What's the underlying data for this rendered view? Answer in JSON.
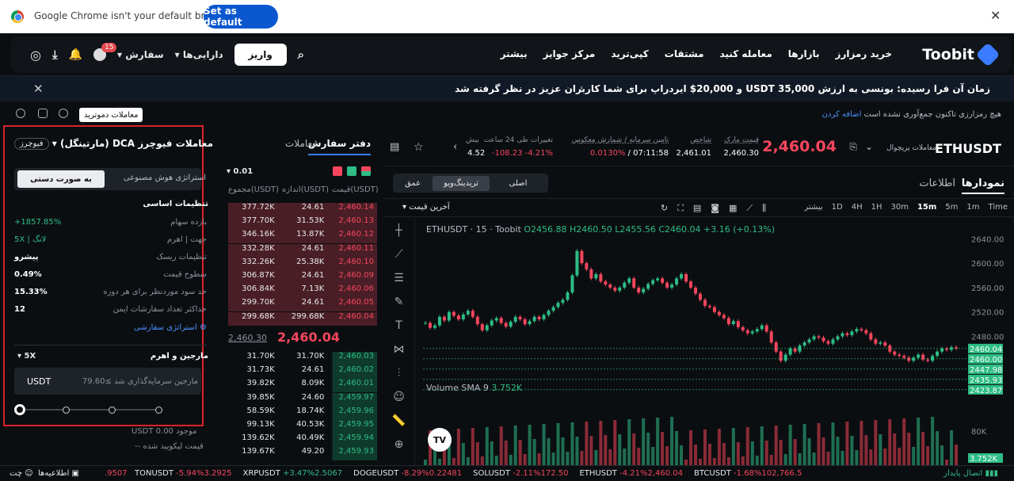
{
  "chrome": {
    "message": "Google Chrome isn't your default browser",
    "set_default": "Set as default"
  },
  "nav": {
    "brand": "Toobit",
    "items": [
      "خرید رمزارز",
      "بازارها",
      "معامله کنید",
      "مشتقات",
      "کپی‌ترید",
      "مرکز جوایز",
      "بیشتر"
    ],
    "deposit": "واریز",
    "assets": "دارایی‌ها",
    "orders": "سفارش",
    "badge": "15"
  },
  "banner": {
    "text": "زمان آن فرا رسیده: بونسی به ارزش USDT 35,000 و 20,000$ ایردراپ برای شما کاربران عزیز در نظر گرفته شد"
  },
  "subbar": {
    "demo": "معاملات دموترید",
    "notice": "هیچ رمزارزی تاکنون جمع‌آوری نشده است",
    "notice_link": "اضافه کردن"
  },
  "left_panel": {
    "title": "معاملات فیوچرز DCA (مارتینگل)",
    "type_btn": "فیوچرز",
    "tabs": [
      "استراتژی هوش مصنوعی",
      "به صورت دستی"
    ],
    "basic": "تنظیمات اساسی",
    "rows": [
      [
        "بازده سهام",
        "1857.85%+"
      ],
      [
        "جهت | اهرم",
        "لانگ | 5X"
      ],
      [
        "تنظیمات ریسک",
        "پیشرو"
      ],
      [
        "سطوح قیمت",
        "0.49%"
      ],
      [
        "حد سود موردنظر برای هر دوره",
        "15.33%"
      ],
      [
        "حداکثر تعداد سفارشات ایمن",
        "12"
      ]
    ],
    "strategy": "استراتژی سفارشی",
    "margin": "مارجین و اهرم",
    "lev": "5X",
    "input_placeholder": "مارجین سرمایه‌گذاری شد ≥79.60",
    "unit": "USDT"
  },
  "orderbook": {
    "tabs": [
      "دفتر سفارش",
      "معاملات"
    ],
    "precision": "0.01",
    "headers": [
      "قیمت(USDT)",
      "اندازه(USDT)",
      "مجموع(USDT)"
    ],
    "asks": [
      [
        "2,460.14",
        "24.61",
        "377.72K"
      ],
      [
        "2,460.13",
        "31.53K",
        "377.70K"
      ],
      [
        "2,460.12",
        "13.87K",
        "346.16K"
      ],
      [
        "2,460.11",
        "24.61",
        "332.28K"
      ],
      [
        "2,460.10",
        "25.38K",
        "332.26K"
      ],
      [
        "2,460.09",
        "24.61",
        "306.87K"
      ],
      [
        "2,460.06",
        "7.13K",
        "306.84K"
      ],
      [
        "2,460.05",
        "24.61",
        "299.70K"
      ],
      [
        "2,460.04",
        "299.68K",
        "299.68K"
      ]
    ],
    "last": "2,460.04",
    "mark": "2,460.30",
    "bids": [
      [
        "2,460.03",
        "31.70K",
        "31.70K"
      ],
      [
        "2,460.02",
        "24.61",
        "31.73K"
      ],
      [
        "2,460.01",
        "8.09K",
        "39.82K"
      ],
      [
        "2,459.97",
        "24.60",
        "39.85K"
      ],
      [
        "2,459.96",
        "18.74K",
        "58.59K"
      ],
      [
        "2,459.95",
        "40.53K",
        "99.13K"
      ],
      [
        "2,459.94",
        "40.49K",
        "139.62K"
      ],
      [
        "2,459.93",
        "49.20",
        "139.67K"
      ]
    ]
  },
  "ticker": {
    "symbol": "ETHUSDT",
    "kind": "معاملات پرپچوال",
    "price": "2,460.04",
    "mark_label": "قیمت مارک",
    "mark": "2,460.30",
    "index_label": "شاخص",
    "index": "2,461.01",
    "funding_label": "تامین سرمایه / شمارش معکوس",
    "funding": "0.0130%",
    "countdown": "07:11:58",
    "change_label": "تغییرات طی 24 ساعت",
    "change": "-108.23 -4.21%",
    "high_label": "بیش",
    "high": "4.52"
  },
  "chart_tabs": {
    "main": "نمودارها",
    "info": "اطلاعات",
    "views": [
      "اصلی",
      "تریدینگ‌ویو",
      "عمق"
    ],
    "times": [
      "Time",
      "1m",
      "5m",
      "15m",
      "30m",
      "1H",
      "4H",
      "1D",
      "بیشتر"
    ],
    "last_price": "آخرین قیمت"
  },
  "chart_legend": {
    "symbol": "ETHUSDT · 15 · Toobit",
    "o": "O2456.88",
    "h": "H2460.50",
    "l": "L2455.56",
    "c": "C2460.04",
    "chg": "+3.16 (+0.13%)",
    "vol": "Volume SMA 9",
    "vol_val": "3.752K"
  },
  "price_axis": [
    "2640.00",
    "2600.00",
    "2560.00",
    "2520.00",
    "2480.00",
    "2460.04",
    "2460.00",
    "2447.98",
    "2435.93",
    "2423.87",
    "80K",
    "3.752K"
  ],
  "footer": {
    "items": [
      [
        "TONUSDT",
        "-5.94%3.2925"
      ],
      [
        "XRPUSDT",
        "+3.47%2.5067"
      ],
      [
        "DOGEUSDT",
        "-8.29%0.22481"
      ],
      [
        "SOLUSDT",
        "-2.11%172.50"
      ],
      [
        "ETHUSDT",
        "-4.21%2,460.04"
      ],
      [
        "BTCUSDT",
        "-1.68%102,766.5"
      ]
    ],
    "first_val": ".9507",
    "conn": "اتصال پایدار",
    "chat": "چت",
    "notice": "اطلاعیه‌ها"
  },
  "chart_data": {
    "type": "candlestick",
    "symbol": "ETHUSDT",
    "interval": "15",
    "ylim": [
      2400,
      2660
    ],
    "closes": [
      2502,
      2494,
      2498,
      2512,
      2506,
      2520,
      2514,
      2508,
      2516,
      2522,
      2512,
      2500,
      2490,
      2498,
      2506,
      2510,
      2502,
      2496,
      2504,
      2512,
      2508,
      2500,
      2505,
      2512,
      2508,
      2515,
      2522,
      2528,
      2535,
      2540,
      2552,
      2580,
      2620,
      2600,
      2590,
      2575,
      2582,
      2570,
      2565,
      2560,
      2555,
      2560,
      2568,
      2575,
      2560,
      2552,
      2558,
      2566,
      2572,
      2575,
      2568,
      2560,
      2565,
      2575,
      2582,
      2570,
      2560,
      2550,
      2540,
      2530,
      2528,
      2520,
      2515,
      2510,
      2500,
      2505,
      2495,
      2490,
      2485,
      2488,
      2492,
      2498,
      2488,
      2470,
      2455,
      2440,
      2450,
      2460,
      2455,
      2465,
      2470,
      2475,
      2480,
      2478,
      2472,
      2468,
      2475,
      2480,
      2485,
      2482,
      2488,
      2492,
      2490,
      2485,
      2475,
      2468,
      2470,
      2465,
      2455,
      2450,
      2448,
      2445,
      2440,
      2445,
      2450,
      2442,
      2440,
      2448,
      2455,
      2460,
      2458,
      2462,
      2460
    ]
  }
}
